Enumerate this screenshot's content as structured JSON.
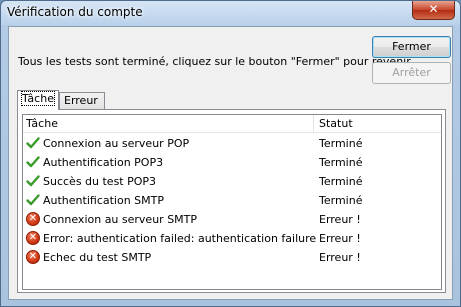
{
  "window": {
    "title": "Vérification du compte",
    "close_glyph": "✕"
  },
  "message": "Tous les tests sont terminé, cliquez sur le bouton \"Fermer\" pour revenir.",
  "buttons": {
    "close": "Fermer",
    "stop": "Arrêter"
  },
  "tabs": [
    {
      "label": "Tâche",
      "active": true
    },
    {
      "label": "Erreur",
      "active": false
    }
  ],
  "list": {
    "columns": [
      "Tâche",
      "Statut"
    ],
    "rows": [
      {
        "task": "Connexion au serveur POP",
        "status": "Terminé",
        "icon": "check-icon"
      },
      {
        "task": "Authentification POP3",
        "status": "Terminé",
        "icon": "check-icon"
      },
      {
        "task": "Succès du test POP3",
        "status": "Terminé",
        "icon": "check-icon"
      },
      {
        "task": "Authentification SMTP",
        "status": "Terminé",
        "icon": "check-icon"
      },
      {
        "task": "Connexion au serveur SMTP",
        "status": "Erreur !",
        "icon": "error-icon"
      },
      {
        "task": "Error: authentication failed: authentication failure",
        "status": "Erreur !",
        "icon": "error-icon"
      },
      {
        "task": "Echec du test SMTP",
        "status": "Erreur !",
        "icon": "error-icon"
      }
    ]
  },
  "colors": {
    "success": "#3a9a2a",
    "error": "#d43b17",
    "title_bar": "#b9d1ea"
  }
}
